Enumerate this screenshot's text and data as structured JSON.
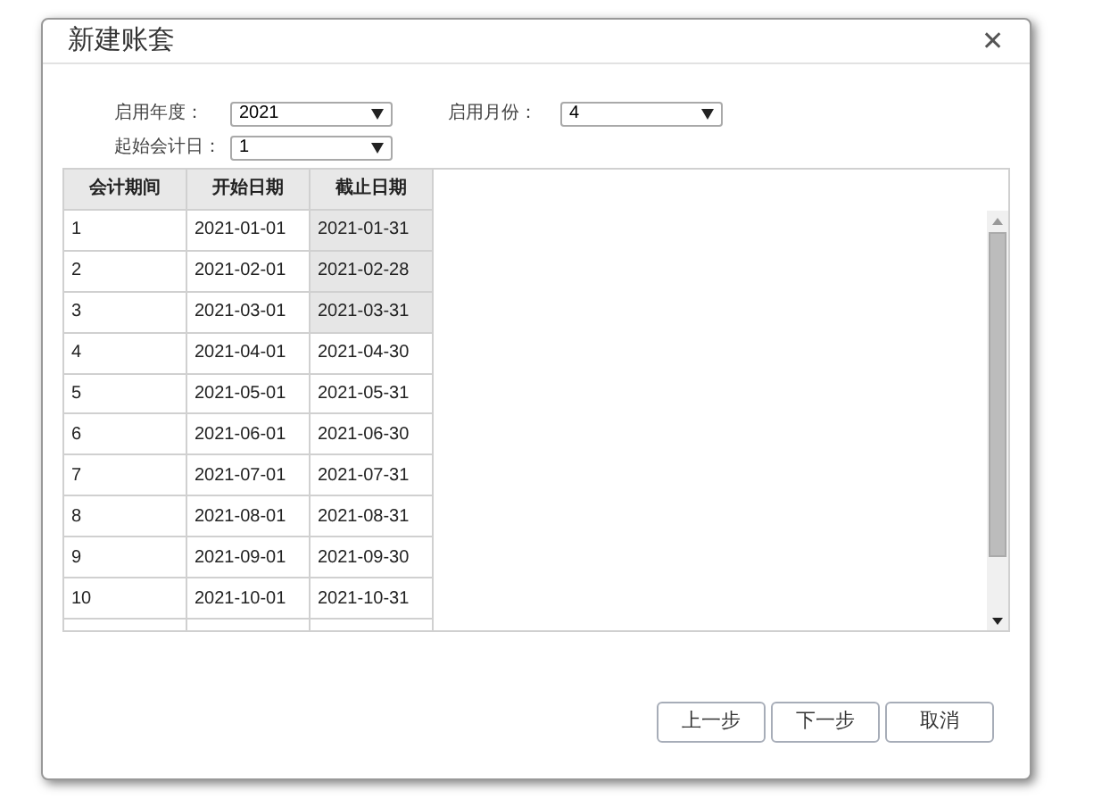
{
  "dialog": {
    "title": "新建账套",
    "close": "✕"
  },
  "fields": [
    {
      "label": "启用年度：",
      "value": "2021"
    },
    {
      "label": "启用月份：",
      "value": "4"
    },
    {
      "label": "起始会计日：",
      "value": "1"
    }
  ],
  "table": {
    "columns": [
      "会计期间",
      "开始日期",
      "截止日期"
    ],
    "rows": [
      {
        "period": "1",
        "start": "2021-01-01",
        "end": "2021-01-31",
        "disabled": true
      },
      {
        "period": "2",
        "start": "2021-02-01",
        "end": "2021-02-28",
        "disabled": true
      },
      {
        "period": "3",
        "start": "2021-03-01",
        "end": "2021-03-31",
        "disabled": true
      },
      {
        "period": "4",
        "start": "2021-04-01",
        "end": "2021-04-30",
        "disabled": false
      },
      {
        "period": "5",
        "start": "2021-05-01",
        "end": "2021-05-31",
        "disabled": false
      },
      {
        "period": "6",
        "start": "2021-06-01",
        "end": "2021-06-30",
        "disabled": false
      },
      {
        "period": "7",
        "start": "2021-07-01",
        "end": "2021-07-31",
        "disabled": false
      },
      {
        "period": "8",
        "start": "2021-08-01",
        "end": "2021-08-31",
        "disabled": false
      },
      {
        "period": "9",
        "start": "2021-09-01",
        "end": "2021-09-30",
        "disabled": false
      },
      {
        "period": "10",
        "start": "2021-10-01",
        "end": "2021-10-31",
        "disabled": false
      }
    ]
  },
  "buttons": [
    "上一步",
    "下一步",
    "取消"
  ]
}
